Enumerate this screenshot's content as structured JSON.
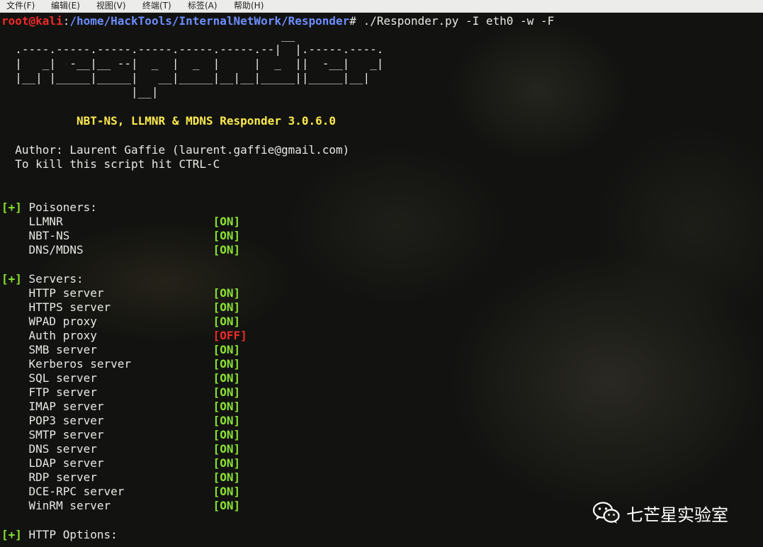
{
  "menubar": {
    "items": [
      "文件(F)",
      "编辑(E)",
      "视图(V)",
      "终端(T)",
      "标签(A)",
      "帮助(H)"
    ]
  },
  "prompt": {
    "user": "root@kali",
    "sep": ":",
    "path": "/home/HackTools/InternalNetWork/Responder",
    "symbol": "#",
    "command": " ./Responder.py -I eth0 -w -F"
  },
  "banner": [
    "                                         __",
    "  .----.-----.-----.-----.-----.-----.--|  |.-----.----.",
    "  |   _|  -__|__ --|  _  |  _  |     |  _  ||  -__|   _|",
    "  |__| |_____|_____|   __|_____|__|__|_____||_____|__|",
    "                   |__|"
  ],
  "title_line": "           NBT-NS, LLMNR & MDNS Responder 3.0.6.0",
  "author_line": "  Author: Laurent Gaffie (laurent.gaffie@gmail.com)",
  "kill_line": "  To kill this script hit CTRL-C",
  "sections": {
    "poisoners": {
      "tag": "[+]",
      "title": " Poisoners:",
      "items": [
        {
          "name": "    LLMNR                      ",
          "status": "[ON]"
        },
        {
          "name": "    NBT-NS                     ",
          "status": "[ON]"
        },
        {
          "name": "    DNS/MDNS                   ",
          "status": "[ON]"
        }
      ]
    },
    "servers": {
      "tag": "[+]",
      "title": " Servers:",
      "items": [
        {
          "name": "    HTTP server                ",
          "status": "[ON]"
        },
        {
          "name": "    HTTPS server               ",
          "status": "[ON]"
        },
        {
          "name": "    WPAD proxy                 ",
          "status": "[ON]"
        },
        {
          "name": "    Auth proxy                 ",
          "status": "[OFF]"
        },
        {
          "name": "    SMB server                 ",
          "status": "[ON]"
        },
        {
          "name": "    Kerberos server            ",
          "status": "[ON]"
        },
        {
          "name": "    SQL server                 ",
          "status": "[ON]"
        },
        {
          "name": "    FTP server                 ",
          "status": "[ON]"
        },
        {
          "name": "    IMAP server                ",
          "status": "[ON]"
        },
        {
          "name": "    POP3 server                ",
          "status": "[ON]"
        },
        {
          "name": "    SMTP server                ",
          "status": "[ON]"
        },
        {
          "name": "    DNS server                 ",
          "status": "[ON]"
        },
        {
          "name": "    LDAP server                ",
          "status": "[ON]"
        },
        {
          "name": "    RDP server                 ",
          "status": "[ON]"
        },
        {
          "name": "    DCE-RPC server             ",
          "status": "[ON]"
        },
        {
          "name": "    WinRM server               ",
          "status": "[ON]"
        }
      ]
    },
    "http_options": {
      "tag": "[+]",
      "title": " HTTP Options:"
    }
  },
  "watermark": {
    "icon": "wechat-icon",
    "text": "七芒星实验室"
  },
  "colors": {
    "ok": "#8ae234",
    "off": "#ef2929",
    "prompt_user": "#ef2929",
    "prompt_path": "#6d8dff",
    "title": "#fce94f"
  }
}
